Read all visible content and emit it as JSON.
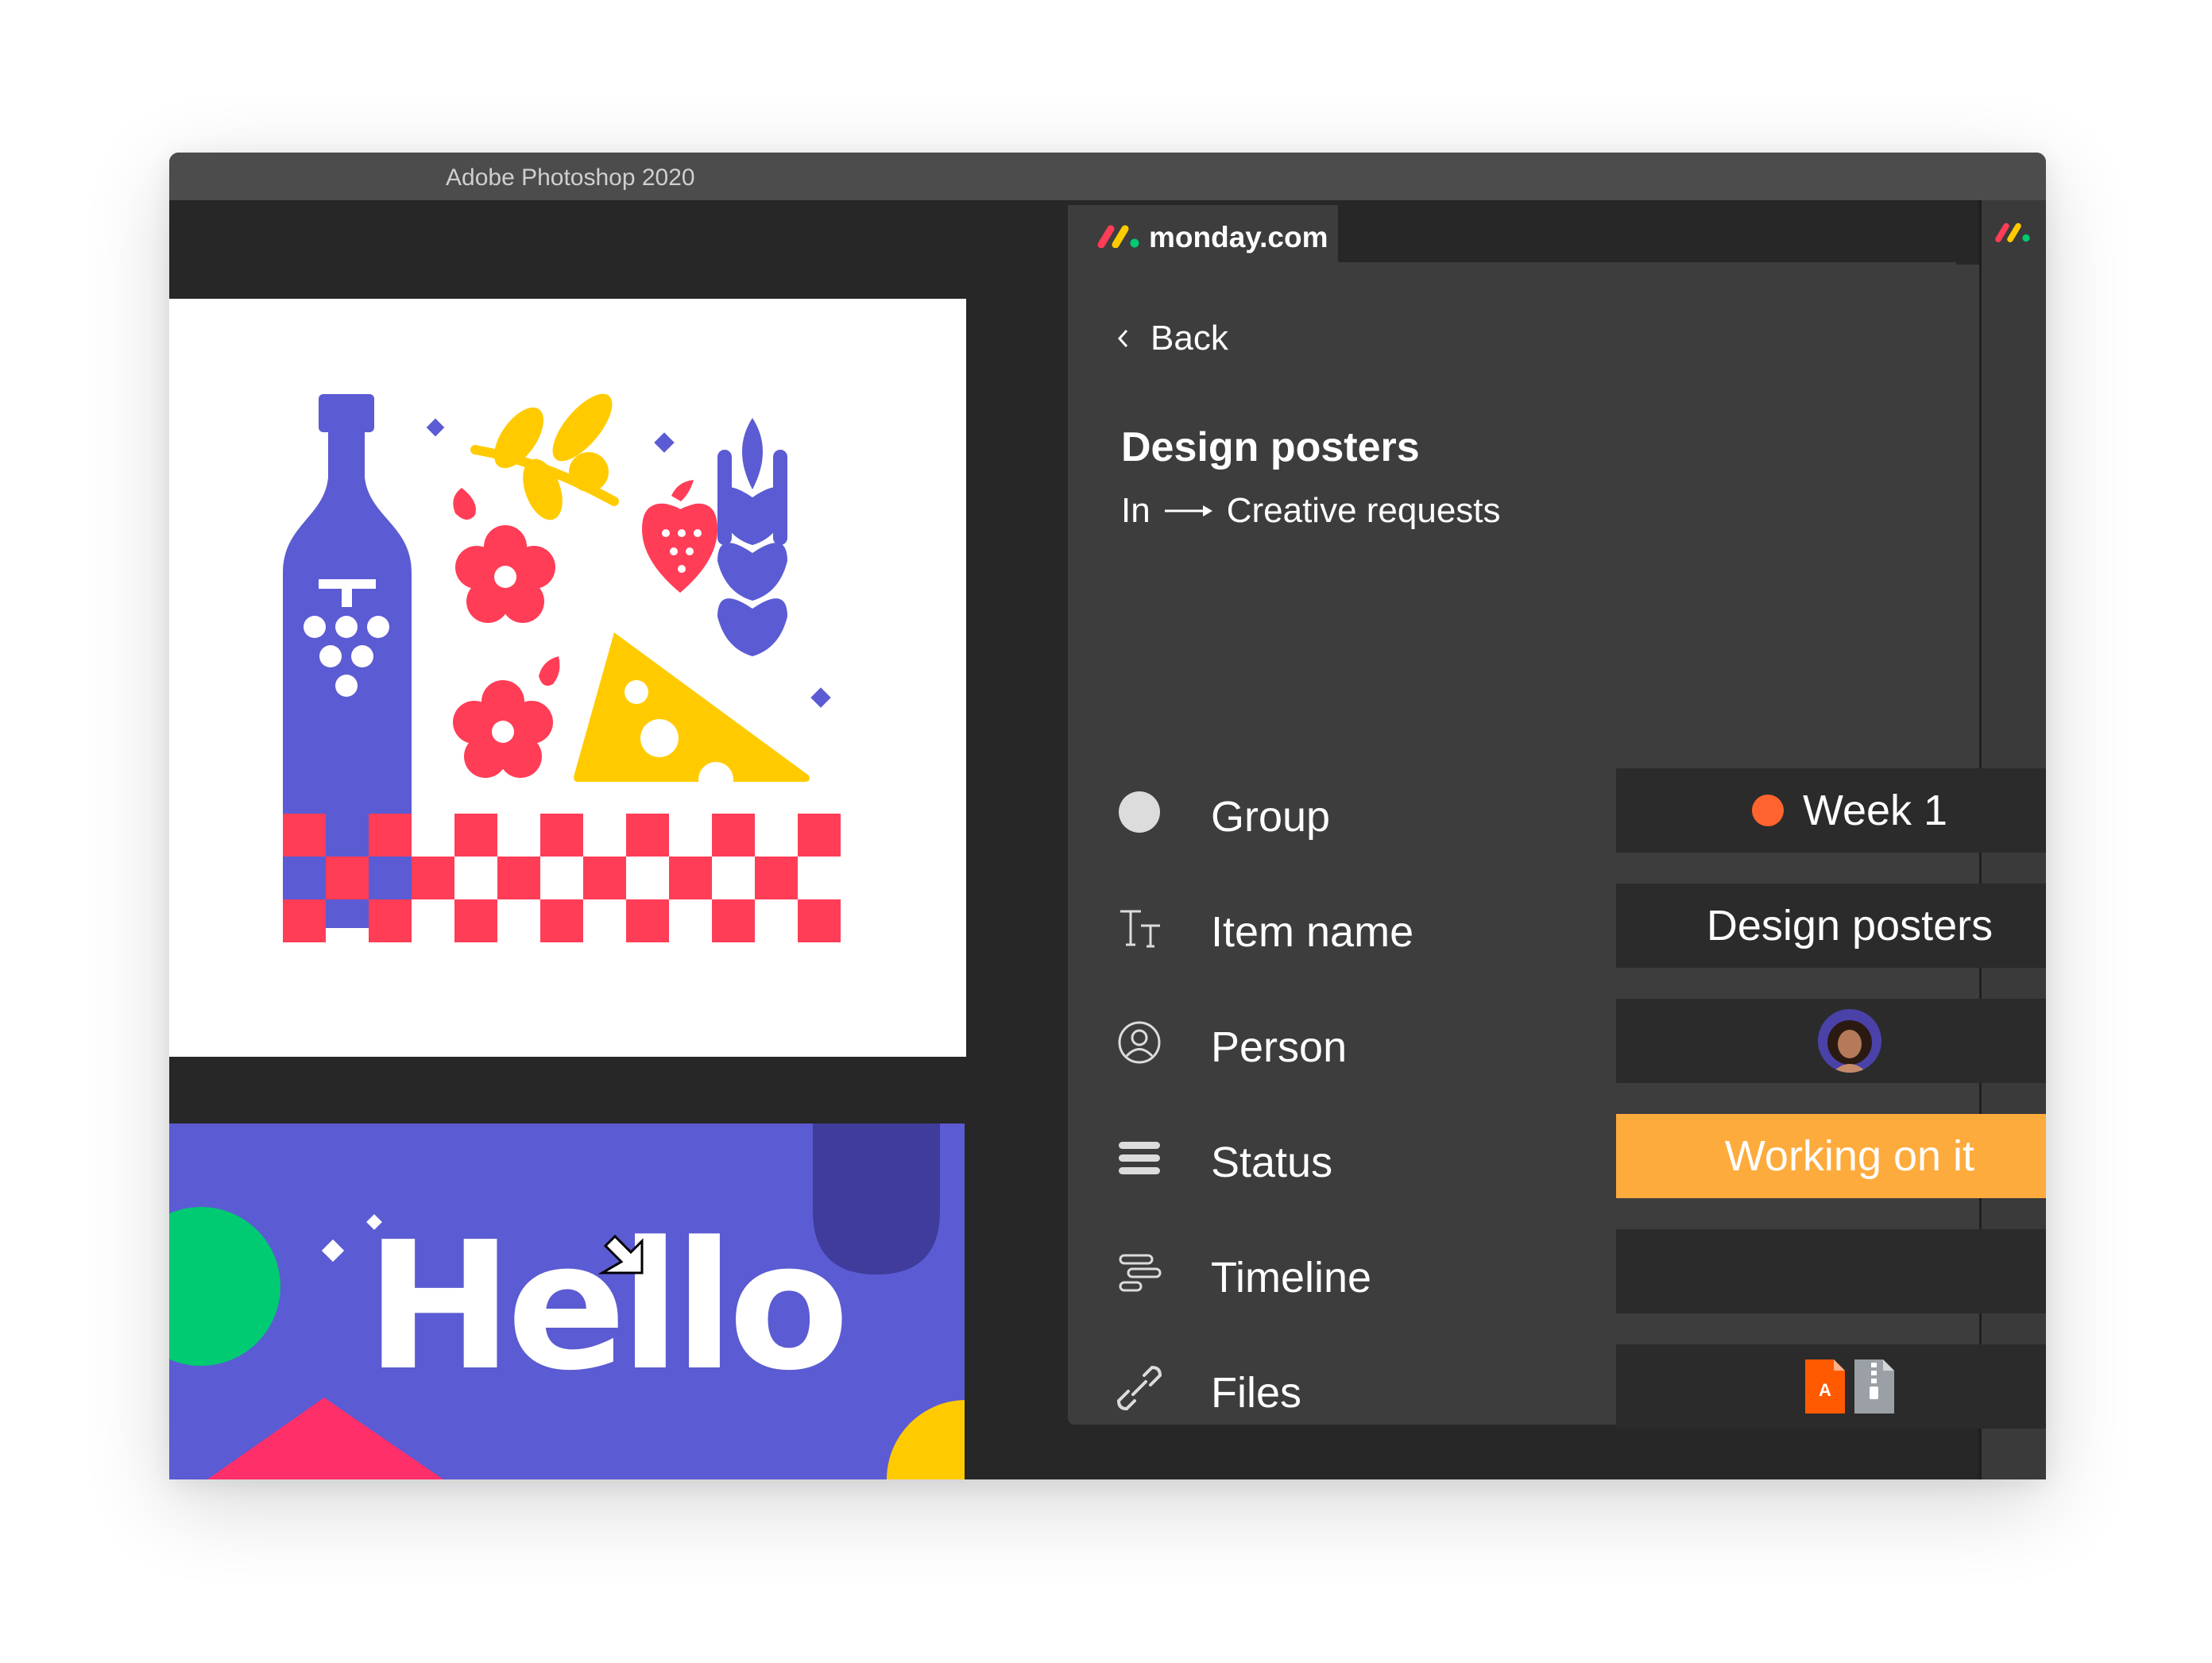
{
  "window": {
    "title": "Adobe Photoshop 2020"
  },
  "canvas": {
    "hello_text": "Hello"
  },
  "panel": {
    "brand": "monday.com",
    "back_label": "Back",
    "item_title": "Design posters",
    "breadcrumb_prefix": "In",
    "breadcrumb_board": "Creative requests",
    "columns": [
      {
        "label": "Group",
        "icon": "circle-icon",
        "value": "Week 1",
        "value_color": "#ff642e"
      },
      {
        "label": "Item name",
        "icon": "text-icon",
        "value": "Design posters"
      },
      {
        "label": "Person",
        "icon": "person-icon",
        "value": ""
      },
      {
        "label": "Status",
        "icon": "status-icon",
        "value": "Working on it",
        "value_color": "#fdab3d"
      },
      {
        "label": "Timeline",
        "icon": "timeline-icon",
        "value": ""
      },
      {
        "label": "Files",
        "icon": "paperclip-icon",
        "value": ""
      }
    ],
    "files": [
      {
        "type": "pdf-file-icon",
        "badge": "A",
        "color": "#ff5a00"
      },
      {
        "type": "zip-file-icon",
        "color": "#9aa0a6"
      }
    ]
  },
  "colors": {
    "brand_red": "#ff3d57",
    "brand_yellow": "#ffcb00",
    "brand_green": "#00ca72",
    "canvas_purple": "#5b5bd3"
  }
}
